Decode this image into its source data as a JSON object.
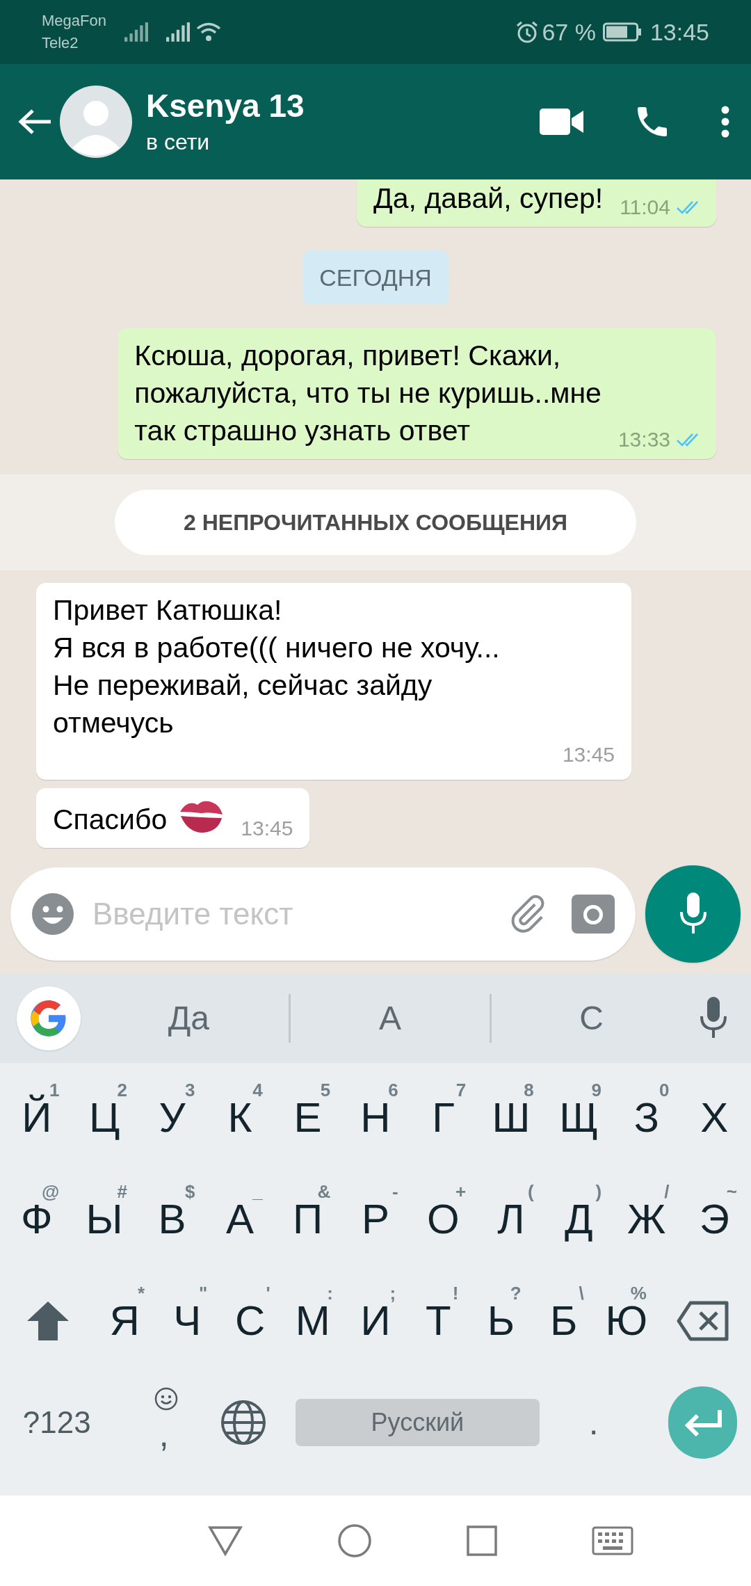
{
  "status_bar": {
    "carriers": [
      "MegaFon",
      "Tele2"
    ],
    "battery_percent": "67 %",
    "time": "13:45"
  },
  "header": {
    "name": "Ksenya 13",
    "status": "в сети"
  },
  "messages": [
    {
      "kind": "outgoing",
      "text": "Да, давай, супер!",
      "time": "11:04",
      "read": true
    },
    {
      "kind": "date",
      "text": "СЕГОДНЯ"
    },
    {
      "kind": "outgoing",
      "text": "Ксюша, дорогая, привет! Скажи,\nпожалуйста, что ты не куришь..мне\nтак страшно узнать ответ",
      "time": "13:33",
      "read": true
    },
    {
      "kind": "unread",
      "text": "2 НЕПРОЧИТАННЫХ СООБЩЕНИЯ"
    },
    {
      "kind": "incoming",
      "text": "Привет Катюшка!\nЯ вся в работе((( ничего не хочу...\nНе переживай, сейчас зайду\nотмечусь",
      "time": "13:45"
    },
    {
      "kind": "incoming",
      "text": "Спасибо",
      "emoji": true,
      "time": "13:45"
    }
  ],
  "composer": {
    "placeholder": "Введите текст"
  },
  "suggestions": [
    "Да",
    "А",
    "С"
  ],
  "keyboard": {
    "rows": [
      [
        {
          "label": "Й",
          "hint": "1"
        },
        {
          "label": "Ц",
          "hint": "2"
        },
        {
          "label": "У",
          "hint": "3"
        },
        {
          "label": "К",
          "hint": "4"
        },
        {
          "label": "Е",
          "hint": "5"
        },
        {
          "label": "Н",
          "hint": "6"
        },
        {
          "label": "Г",
          "hint": "7"
        },
        {
          "label": "Ш",
          "hint": "8"
        },
        {
          "label": "Щ",
          "hint": "9"
        },
        {
          "label": "З",
          "hint": "0"
        },
        {
          "label": "Х"
        }
      ],
      [
        {
          "label": "Ф",
          "hint": "@"
        },
        {
          "label": "Ы",
          "hint": "#"
        },
        {
          "label": "В",
          "hint": "$"
        },
        {
          "label": "А",
          "hint": "_"
        },
        {
          "label": "П",
          "hint": "&"
        },
        {
          "label": "Р",
          "hint": "-"
        },
        {
          "label": "О",
          "hint": "+"
        },
        {
          "label": "Л",
          "hint": "("
        },
        {
          "label": "Д",
          "hint": ")"
        },
        {
          "label": "Ж",
          "hint": "/"
        },
        {
          "label": "Э",
          "hint": "~"
        }
      ],
      [
        {
          "kind": "shift"
        },
        {
          "label": "Я",
          "hint": "*"
        },
        {
          "label": "Ч",
          "hint": "\""
        },
        {
          "label": "С",
          "hint": "'"
        },
        {
          "label": "М",
          "hint": ":"
        },
        {
          "label": "И",
          "hint": ";"
        },
        {
          "label": "Т",
          "hint": "!"
        },
        {
          "label": "Ь",
          "hint": "?"
        },
        {
          "label": "Б",
          "hint": "\\"
        },
        {
          "label": "Ю",
          "hint": "%"
        },
        {
          "kind": "backspace"
        }
      ]
    ],
    "bottom_row": {
      "symbols": "?123",
      "comma": ",",
      "space": "Русский",
      "period": "."
    }
  }
}
